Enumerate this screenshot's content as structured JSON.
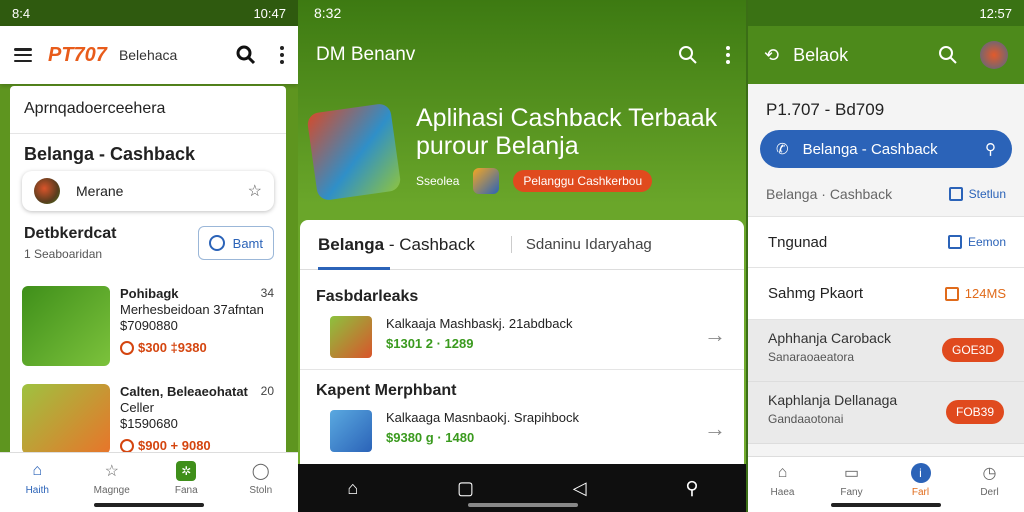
{
  "left": {
    "status": {
      "time": "8:4",
      "right": "10:47"
    },
    "brand": "PT707",
    "brand_sub": "Belehaca",
    "header": "Aprnqadoerceehera",
    "title": "Belanga - Cashback",
    "chip": {
      "label": "Merane"
    },
    "section": {
      "title": "Detbkerdcat",
      "subtitle": "1 Seaboaridan",
      "button": "Bamt"
    },
    "cards": [
      {
        "title": "Pohibagk",
        "line1": "Merhesbeidoan 37afntan",
        "line2": "$7090880",
        "price": "$300 ‡9380",
        "num": "34"
      },
      {
        "title": "Calten, Beleaeohatat",
        "line1": "Celler",
        "line2": "$1590680",
        "price": "$900 + 9080",
        "num": "20"
      }
    ],
    "nav": [
      "Haith",
      "Magnge",
      "Fana",
      "Stoln"
    ]
  },
  "middle": {
    "status": {
      "time": "8:32"
    },
    "title": "DM Benanv",
    "hero": {
      "line1": "Aplihasi Cashback Terbaak",
      "line2": "purour Belanja",
      "label": "Sseolea",
      "pill": "Pelanggu Cashkerbou"
    },
    "tabs": {
      "active_bold": "Belanga",
      "active_rest": " - Cashback",
      "other": "Sdaninu Idaryahag"
    },
    "list": [
      {
        "heading": "Fasbdarleaks",
        "name": "Kalkaaja Mashbaskj. 21abdback",
        "price": "$1301 2 · 1289"
      },
      {
        "heading": "Kapent Merphbant",
        "name": "Kalkaaga Masnbaokj. Srapihbock",
        "price": "$9380 g · 1480"
      }
    ]
  },
  "right": {
    "status": {
      "right": "12:57"
    },
    "title": "Belaok",
    "id": "P1.707 - Bd709",
    "pill": "Belanga - Cashback",
    "row1": {
      "left": "Belanga · Cashback",
      "link": "Stetlun"
    },
    "row2": {
      "left": "Tngunad",
      "link": "Eemon"
    },
    "row3": {
      "left": "Sahmg Pkaort",
      "value": "124MS"
    },
    "offers": [
      {
        "title": "Aphhanja Caroback",
        "sub": "Sanaraoaeatora",
        "btn": "GOE3D"
      },
      {
        "title": "Kaphlanja Dellanaga",
        "sub": "Gandaaotonai",
        "btn": "FOB39"
      }
    ],
    "nav": [
      "Haea",
      "Fany",
      "Farl",
      "Derl"
    ]
  },
  "colors": {
    "brand": "#e85c1b",
    "accent": "#2b63b8",
    "green": "#5e951f",
    "orange": "#e04a1e"
  }
}
